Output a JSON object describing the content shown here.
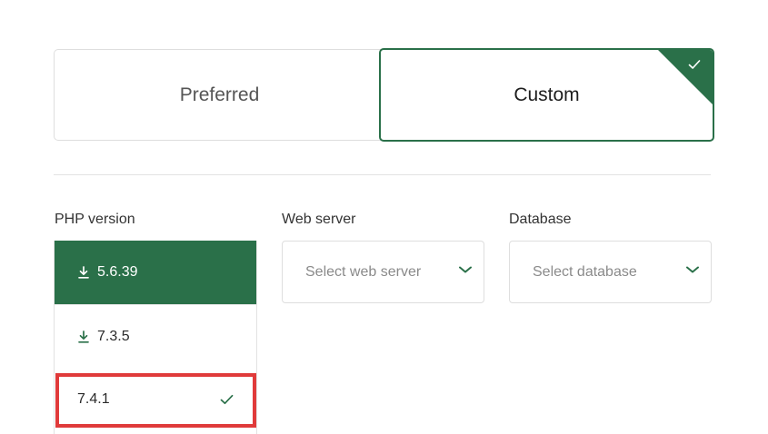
{
  "tabs": {
    "preferred_label": "Preferred",
    "custom_label": "Custom",
    "selected": "Custom"
  },
  "php": {
    "label": "PHP version",
    "versions": [
      {
        "version": "5.6.39",
        "icon": "download-icon",
        "state": "highlighted"
      },
      {
        "version": "7.3.5",
        "icon": "download-icon",
        "state": "normal"
      },
      {
        "version": "7.4.1",
        "icon": "checkmark-icon",
        "state": "checked"
      }
    ]
  },
  "web_server": {
    "label": "Web server",
    "placeholder": "Select web server",
    "icon": "chevron-down-icon"
  },
  "database": {
    "label": "Database",
    "placeholder": "Select database",
    "icon": "chevron-down-icon"
  },
  "colors": {
    "accent": "#2a7049",
    "highlight_box": "#e03a3a",
    "border": "#dedede"
  }
}
